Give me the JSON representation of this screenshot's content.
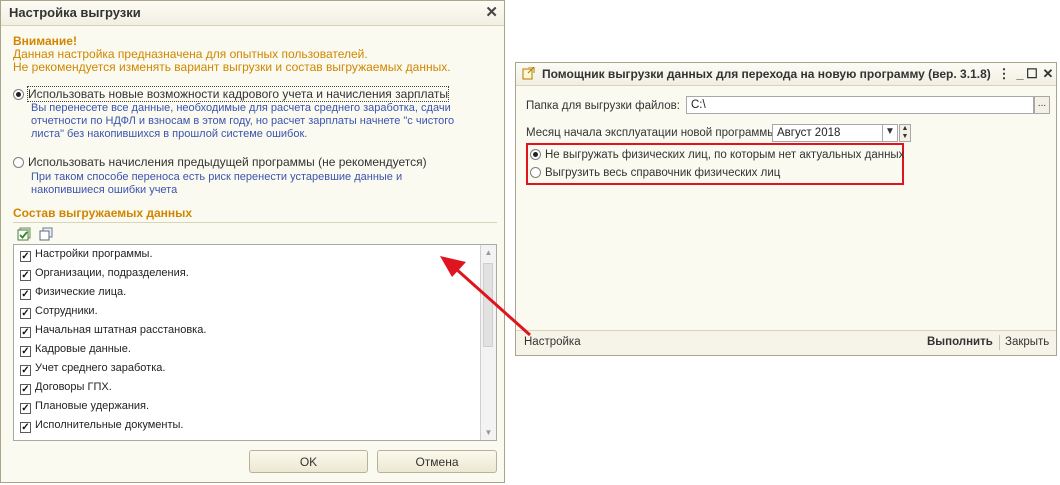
{
  "export_settings": {
    "title": "Настройка выгрузки",
    "warning_lines": [
      "Внимание!",
      "Данная настройка предназначена для опытных пользователей.",
      "Не рекомендуется изменять вариант выгрузки и состав выгружаемых данных."
    ],
    "option_new": {
      "label": "Использовать новые возможности кадрового учета и начисления зарплаты",
      "description": "Вы перенесете все данные, необходимые для расчета среднего заработка, сдачи отчетности по НДФЛ и взносам в этом году, но расчет зарплаты начнете \"с чистого листа\" без накопившихся в прошлой системе ошибок.",
      "selected": true
    },
    "option_old": {
      "label": "Использовать начисления предыдущей программы (не рекомендуется)",
      "description": "При таком способе переноса есть риск перенести устаревшие данные и накопившиеся ошибки учета",
      "selected": false
    },
    "data_section_title": "Состав выгружаемых данных",
    "toolbar_icons": [
      "check-all-icon",
      "uncheck-all-icon"
    ],
    "items": [
      {
        "label": "Настройки программы.",
        "checked": true
      },
      {
        "label": "Организации, подразделения.",
        "checked": true
      },
      {
        "label": "Физические лица.",
        "checked": true
      },
      {
        "label": "Сотрудники.",
        "checked": true
      },
      {
        "label": "Начальная штатная расстановка.",
        "checked": true
      },
      {
        "label": "Кадровые данные.",
        "checked": true
      },
      {
        "label": "Учет среднего заработка.",
        "checked": true
      },
      {
        "label": "Договоры ГПХ.",
        "checked": true
      },
      {
        "label": "Плановые удержания.",
        "checked": true
      },
      {
        "label": "Исполнительные документы.",
        "checked": true
      }
    ],
    "ok_label": "OK",
    "cancel_label": "Отмена"
  },
  "wizard": {
    "title": "Помощник выгрузки данных для перехода на новую программу (вер. 3.1.8)",
    "folder_label": "Папка для выгрузки файлов:",
    "folder_value": "C:\\",
    "browse_label": "...",
    "month_label": "Месяц начала эксплуатации новой программы:",
    "month_value": "Август 2018",
    "radio_no_inactive": "Не выгружать физических лиц, по которым нет актуальных данных",
    "radio_all": "Выгрузить весь справочник физических лиц",
    "settings_link": "Настройка",
    "run_label": "Выполнить",
    "close_label": "Закрыть"
  },
  "colors": {
    "warning": "#d08600",
    "description": "#3b54b0",
    "highlight": "#e0141e"
  }
}
